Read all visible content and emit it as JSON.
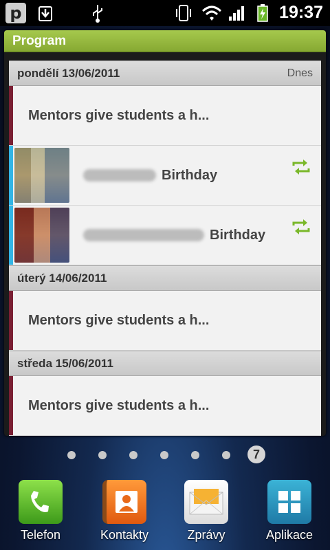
{
  "status_bar": {
    "time": "19:37",
    "app_badge": "p",
    "icons": [
      "p-notification-icon",
      "download-icon",
      "usb-icon",
      "rotation-icon",
      "wifi-icon",
      "signal-icon",
      "battery-charging-icon"
    ]
  },
  "widget": {
    "title": "Program",
    "days": [
      {
        "label": "pondělí 13/06/2011",
        "sub": "Dnes",
        "events": [
          {
            "type": "task",
            "text": "Mentors give students a h...",
            "color": "#7a1f33"
          },
          {
            "type": "birthday",
            "text": "Birthday",
            "color": "#33b5e5",
            "icon": "sync-icon"
          },
          {
            "type": "birthday",
            "text": "Birthday",
            "color": "#33b5e5",
            "icon": "sync-icon"
          }
        ]
      },
      {
        "label": "úterý 14/06/2011",
        "sub": "",
        "events": [
          {
            "type": "task",
            "text": "Mentors give students a h...",
            "color": "#7a1f33"
          }
        ]
      },
      {
        "label": "středa 15/06/2011",
        "sub": "",
        "events": [
          {
            "type": "task",
            "text": "Mentors give students a h...",
            "color": "#7a1f33"
          }
        ]
      }
    ]
  },
  "pager": {
    "current_page": "7",
    "dot_count": 6
  },
  "dock": [
    {
      "label": "Telefon",
      "icon": "phone-icon"
    },
    {
      "label": "Kontakty",
      "icon": "contacts-icon"
    },
    {
      "label": "Zprávy",
      "icon": "messages-icon"
    },
    {
      "label": "Aplikace",
      "icon": "apps-grid-icon"
    }
  ],
  "colors": {
    "header_green": "#98bb40",
    "task_stripe": "#7a1f33",
    "birthday_stripe": "#33b5e5",
    "sync_green": "#7ab82a"
  }
}
